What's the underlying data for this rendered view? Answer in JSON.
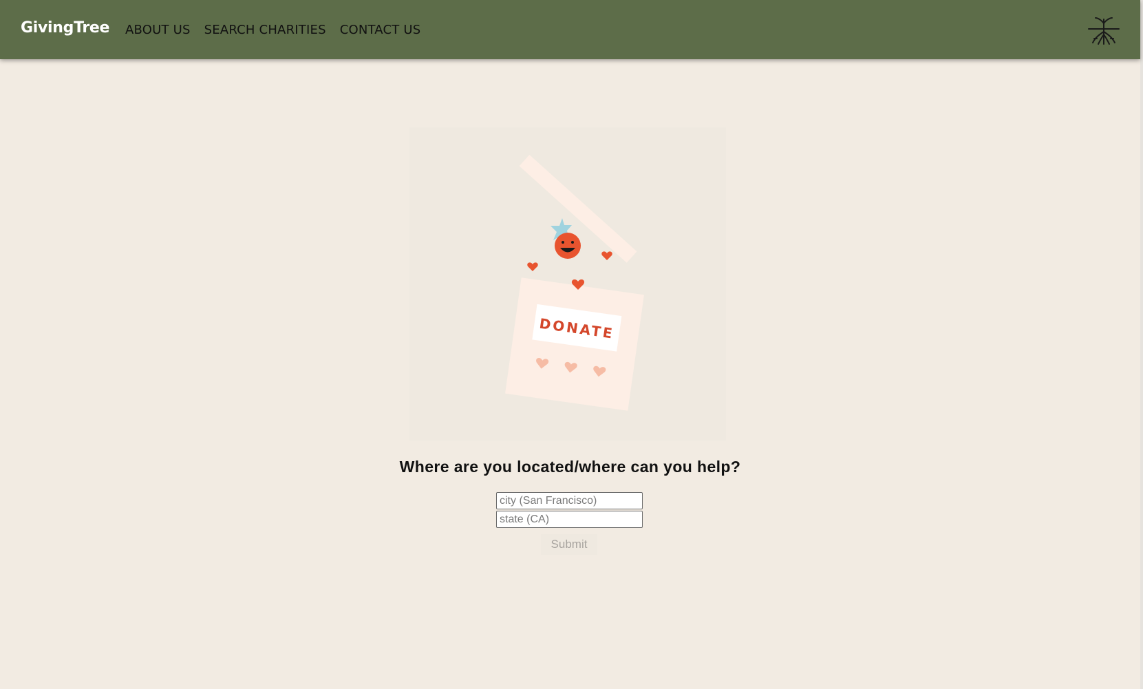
{
  "navbar": {
    "brand": "GivingTree",
    "links": [
      {
        "label": "ABOUT US"
      },
      {
        "label": "SEARCH CHARITIES"
      },
      {
        "label": "CONTACT US"
      }
    ],
    "logo_icon": "tree-roots-icon",
    "background_color": "#5d6d49"
  },
  "hero": {
    "illustration_text": "DONATE",
    "illustration_icons": [
      "donation-box-icon",
      "smiley-face-icon",
      "heart-icon"
    ]
  },
  "form": {
    "question": "Where are you located/where can you help?",
    "city_placeholder": "city (San Francisco)",
    "city_value": "",
    "state_placeholder": "state (CA)",
    "state_value": "",
    "submit_label": "Submit"
  },
  "colors": {
    "page_background": "#f2ebe2",
    "accent": "#e8542f"
  }
}
